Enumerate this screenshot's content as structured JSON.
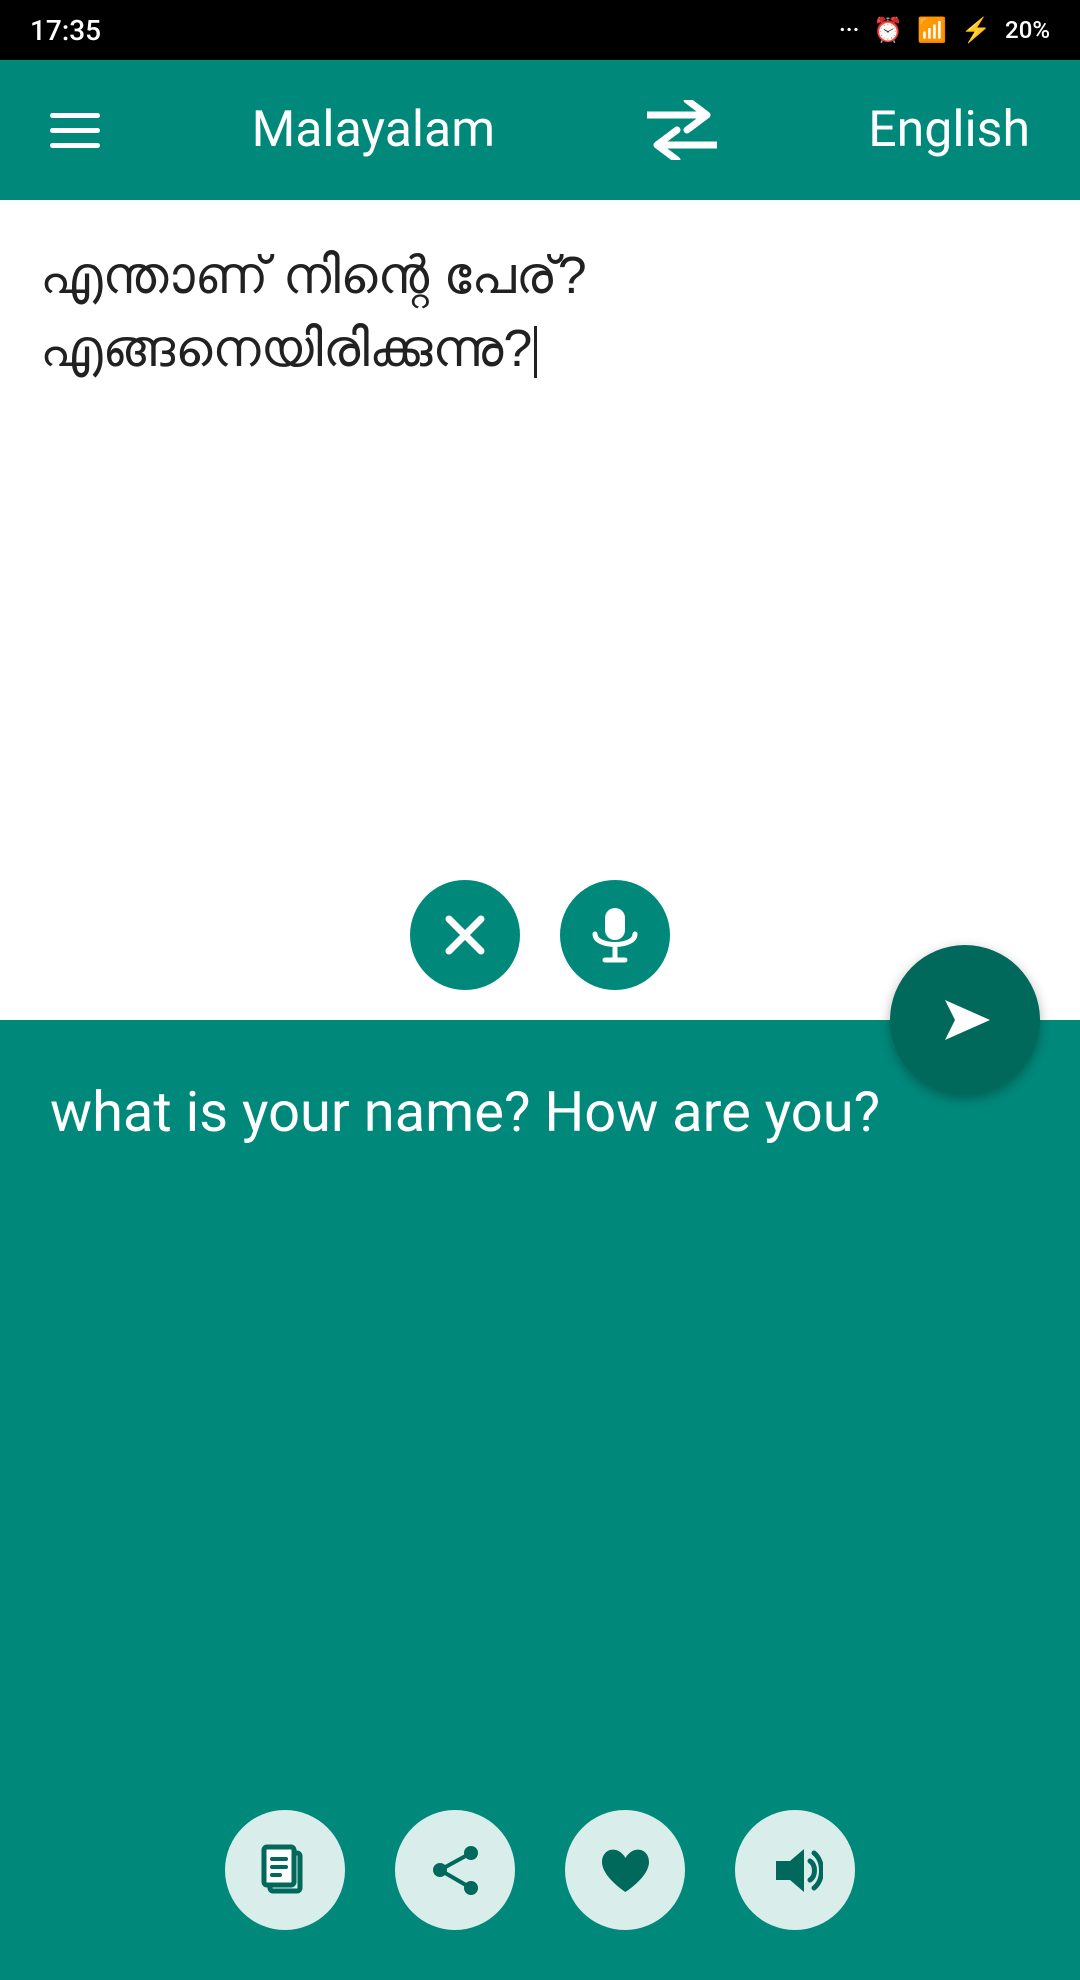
{
  "status": {
    "time": "17:35",
    "battery": "20%"
  },
  "toolbar": {
    "source_lang": "Malayalam",
    "target_lang": "English",
    "swap_icon": "⇄",
    "menu_icon": "menu"
  },
  "input_panel": {
    "text": "എന്താണ് നിന്റെ പേര്? എങ്ങനെയിരിക്കുന്നു?",
    "clear_label": "clear",
    "mic_label": "microphone"
  },
  "output_panel": {
    "text": "what is your name? How are you?",
    "copy_label": "copy",
    "share_label": "share",
    "favorite_label": "favorite",
    "speaker_label": "speaker"
  }
}
